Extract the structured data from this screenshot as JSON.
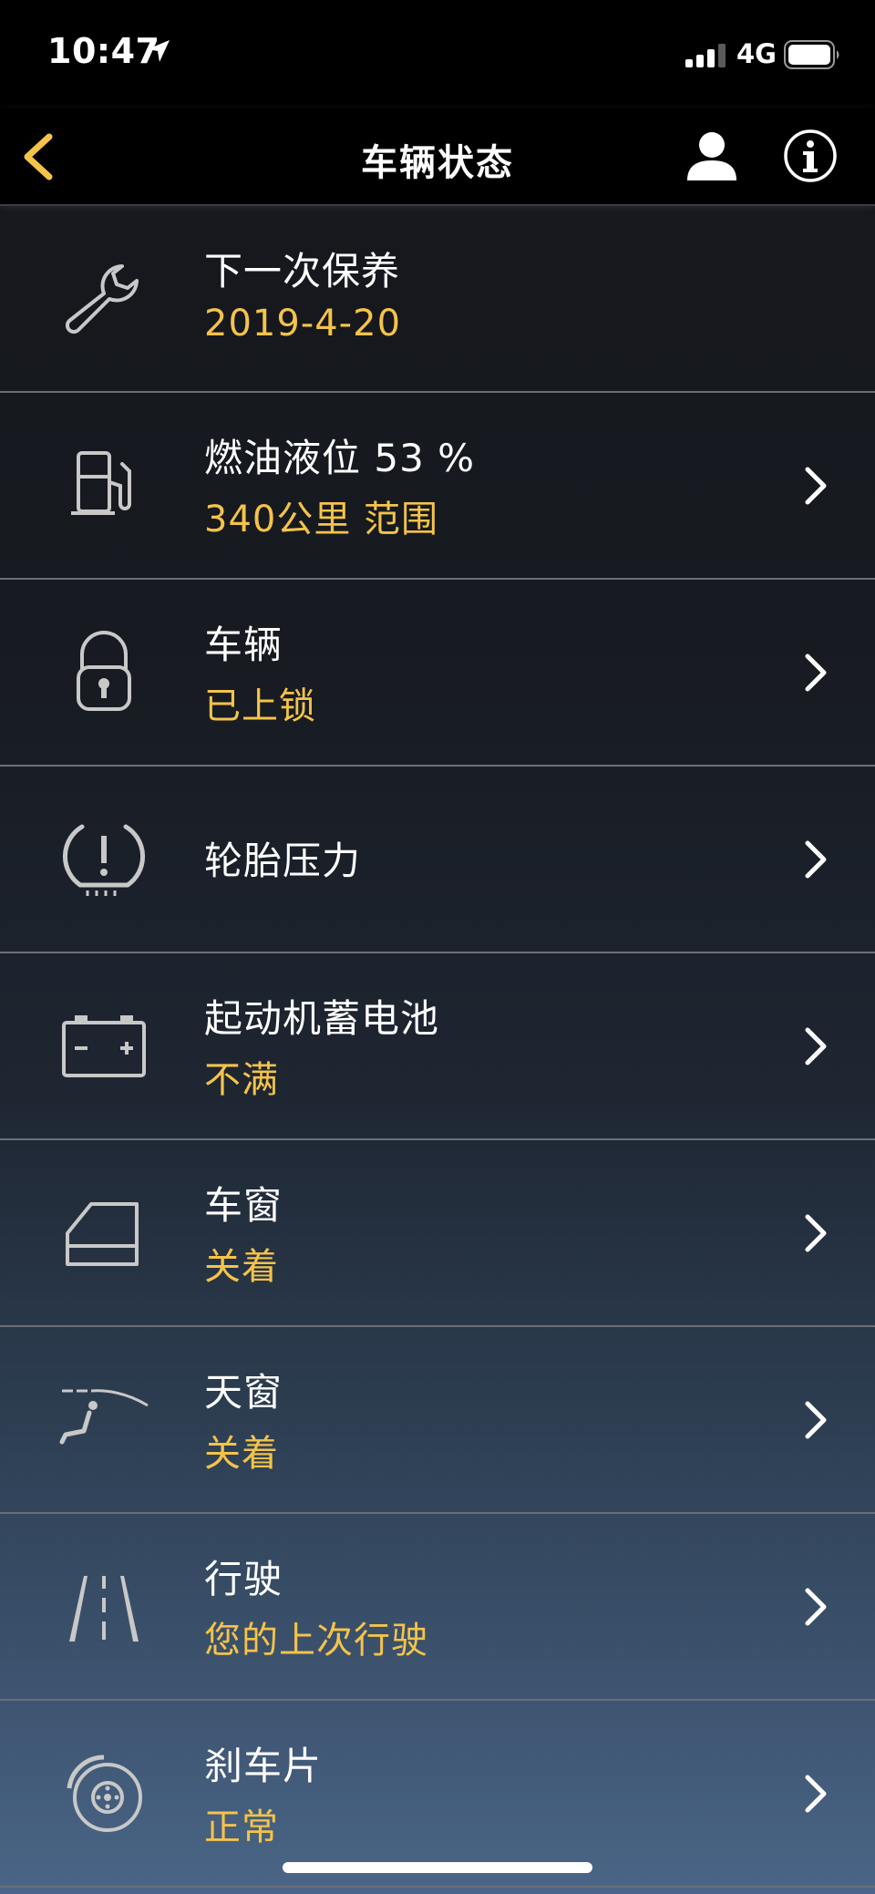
{
  "status_bar": {
    "time": "10:47",
    "network": "4G"
  },
  "nav": {
    "title": "车辆状态"
  },
  "items": [
    {
      "title": "下一次保养",
      "subtitle": "2019-4-20",
      "icon": "wrench-icon"
    },
    {
      "title": "燃油液位 53 %",
      "subtitle": "340公里 范围",
      "icon": "fuel-pump-icon"
    },
    {
      "title": "车辆",
      "subtitle": "已上锁",
      "icon": "padlock-icon"
    },
    {
      "title": "轮胎压力",
      "subtitle": "",
      "icon": "tire-pressure-icon"
    },
    {
      "title": "起动机蓄电池",
      "subtitle": "不满",
      "icon": "battery-icon"
    },
    {
      "title": "车窗",
      "subtitle": "关着",
      "icon": "car-window-icon"
    },
    {
      "title": "天窗",
      "subtitle": "关着",
      "icon": "sunroof-icon"
    },
    {
      "title": "行驶",
      "subtitle": "您的上次行驶",
      "icon": "road-icon"
    },
    {
      "title": "刹车片",
      "subtitle": "正常",
      "icon": "brake-disc-icon"
    }
  ],
  "colors": {
    "accent": "#f4c34a",
    "text": "#ffffff",
    "divider": "#6a6f78"
  }
}
